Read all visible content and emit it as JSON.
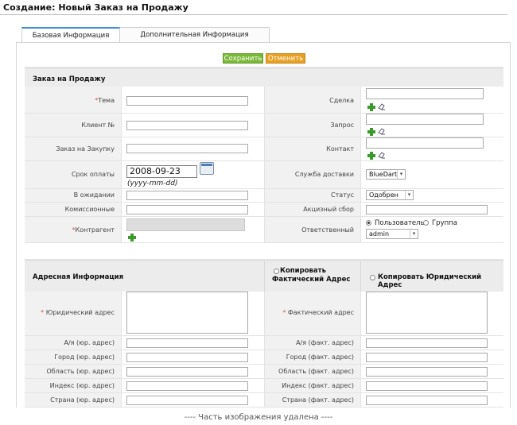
{
  "page": {
    "title": "Создание: Новый Заказ на Продажу"
  },
  "tabs": [
    {
      "label": "Базовая Информация"
    },
    {
      "label": "Дополнительная Информация"
    }
  ],
  "actions": {
    "save": "Сохранить",
    "cancel": "Отменить"
  },
  "section1": {
    "title": "Заказ на Продажу",
    "rows": [
      {
        "left_label": "Тема",
        "right_label": "Сделка"
      },
      {
        "left_label": "Клиент №",
        "right_label": "Запрос"
      },
      {
        "left_label": "Заказ на Закупку",
        "right_label": "Контакт"
      },
      {
        "left_label": "Срок оплаты",
        "right_label": "Служба доставки"
      },
      {
        "left_label": "В ожидании",
        "right_label": "Статус"
      },
      {
        "left_label": "Комиссионные",
        "right_label": "Акцизный сбор"
      },
      {
        "left_label": "Контрагент",
        "right_label": "Ответственный"
      }
    ],
    "due_date": {
      "value": "2008-09-23",
      "hint": "(yyyy-mm-dd)"
    },
    "carrier": {
      "selected": "BlueDart"
    },
    "status": {
      "selected": "Одобрен"
    },
    "assigned": {
      "user_label": "Пользователь",
      "group_label": "Группа",
      "selected": "admin"
    }
  },
  "section2": {
    "title": "Адресная Информация",
    "copy_shipping": "Копировать Фактический Адрес",
    "copy_billing": "Копировать Юридический Адрес",
    "rows": [
      {
        "left_label": "Юридический адрес",
        "right_label": "Фактический адрес"
      },
      {
        "left_label": "А/я (юр. адрес)",
        "right_label": "А/я (факт. адрес)"
      },
      {
        "left_label": "Город (юр. адрес)",
        "right_label": "Город (факт. адрес)"
      },
      {
        "left_label": "Область (юр. адрес)",
        "right_label": "Область (факт. адрес)"
      },
      {
        "left_label": "Индекс (юр. адрес)",
        "right_label": "Индекс (факт. адрес)"
      },
      {
        "left_label": "Страна (юр. адрес)",
        "right_label": "Страна (факт. адрес)"
      }
    ]
  },
  "footer_note": "---- Часть изображения удалена ----"
}
